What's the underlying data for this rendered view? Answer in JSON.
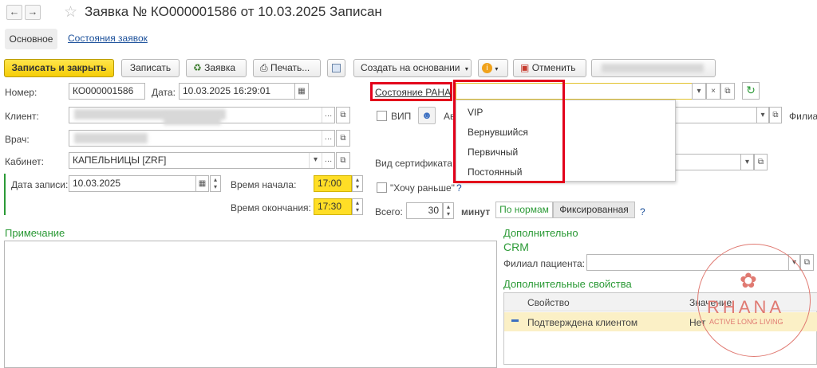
{
  "window": {
    "title": "Заявка № КО000001586 от 10.03.2025 Записан",
    "back_glyph": "←",
    "forward_glyph": "→",
    "star_glyph": "☆"
  },
  "tabs": [
    {
      "label": "Основное",
      "active": true
    },
    {
      "label": "Состояния заявок",
      "active": false
    }
  ],
  "toolbar": {
    "save_close": "Записать и закрыть",
    "save": "Записать",
    "request": "Заявка",
    "print": "Печать...",
    "create_based": "Создать на основании",
    "cancel": "Отменить"
  },
  "form": {
    "number_label": "Номер:",
    "number_value": "КО000001586",
    "date_label": "Дата:",
    "date_value": "10.03.2025 16:29:01",
    "client_label": "Клиент:",
    "doctor_label": "Врач:",
    "cabinet_label": "Кабинет:",
    "cabinet_value": "КАПЕЛЬНИЦЫ [ZRF]",
    "record_date_label": "Дата записи:",
    "record_date_value": "10.03.2025",
    "start_time_label": "Время начала:",
    "start_time_value": "17:00",
    "end_time_label": "Время окончания:",
    "end_time_value": "17:30"
  },
  "right_panel": {
    "state_label": "Состояние РАНА",
    "state_value": "",
    "vip_label": "ВИП",
    "av_label": "Ав",
    "branch_label": "Филиа",
    "certificate_label": "Вид сертификата",
    "want_earlier_label": "\"Хочу раньше\"",
    "help_glyph": "?",
    "total_label": "Всего:",
    "total_value": "30",
    "minutes_label": "минут",
    "by_norms": "По нормам",
    "fixed": "Фиксированная"
  },
  "dropdown": {
    "options": [
      "VIP",
      "Вернувшийся",
      "Первичный",
      "Постоянный"
    ]
  },
  "notes": {
    "title": "Примечание"
  },
  "additional": {
    "title": "Дополнительно",
    "crm": "CRM",
    "patient_branch_label": "Филиал пациента:",
    "props_title": "Дополнительные свойства",
    "col_property": "Свойство",
    "col_value": "Значение",
    "rows": [
      {
        "property": "Подтверждена клиентом",
        "value": "Нет"
      }
    ]
  },
  "watermark": {
    "brand": "RHANA",
    "tagline": "ACTIVE LONG LIVING"
  },
  "colors": {
    "accent_yellow": "#ffde26",
    "green_text": "#2b9a36",
    "link_blue": "#1a4f9a",
    "highlight_red": "#e3001b",
    "watermark": "#e07a72"
  }
}
